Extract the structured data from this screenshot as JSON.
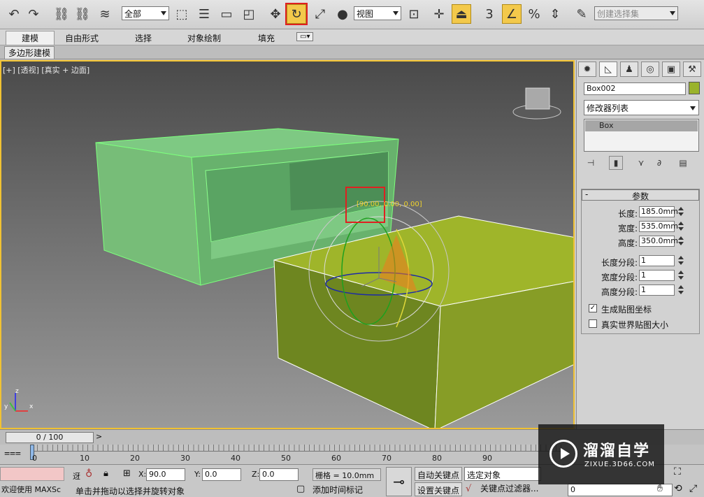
{
  "toolbar": {
    "selection_filter": "全部",
    "coordinate_system": "视图",
    "snap_value": "3",
    "named_selection_placeholder": "创建选择集"
  },
  "ribbon": {
    "tabs": [
      "建模",
      "自由形式",
      "选择",
      "对象绘制",
      "填充"
    ],
    "sub_tab": "多边形建模"
  },
  "viewport": {
    "label": "[+] [透视] [真实 + 边面]",
    "gizmo_readout": "[90.00, 0.00, 0.00]",
    "axis_x": "x",
    "axis_y": "y",
    "axis_z": "z"
  },
  "command_panel": {
    "object_name": "Box002",
    "object_color": "#9ab32c",
    "modifier_list": "修改器列表",
    "stack_item": "Box",
    "rollout_title": "参数",
    "params": [
      {
        "label": "长度:",
        "value": "185.0mm"
      },
      {
        "label": "宽度:",
        "value": "535.0mm"
      },
      {
        "label": "高度:",
        "value": "350.0mm"
      },
      {
        "label": "长度分段:",
        "value": "1"
      },
      {
        "label": "宽度分段:",
        "value": "1"
      },
      {
        "label": "高度分段:",
        "value": "1"
      }
    ],
    "checkbox_gen_uv": {
      "label": "生成贴图坐标",
      "checked": true
    },
    "checkbox_real_world": {
      "label": "真实世界贴图大小",
      "checked": false
    }
  },
  "timeline": {
    "frame_readout": "0 / 100",
    "ticks": [
      "0",
      "10",
      "20",
      "30",
      "40",
      "50",
      "60",
      "70",
      "80",
      "90"
    ]
  },
  "statusbar": {
    "welcome": "欢迎使用 MAXSc",
    "hint_prefix": "迓",
    "hint": "单击并拖动以选择并旋转对象",
    "x_label": "X:",
    "x_value": "90.0",
    "y_label": "Y:",
    "y_value": "0.0",
    "z_label": "Z:",
    "z_value": "0.0",
    "grid": "栅格 = 10.0mm",
    "add_time_tag": "添加时间标记",
    "auto_key": "自动关键点",
    "set_key": "设置关键点",
    "selected_object": "选定对象",
    "key_filters": "关键点过滤器...",
    "current_frame": "0"
  },
  "watermark": {
    "brand": "溜溜自学",
    "url": "ZIXUE.3D66.COM"
  }
}
